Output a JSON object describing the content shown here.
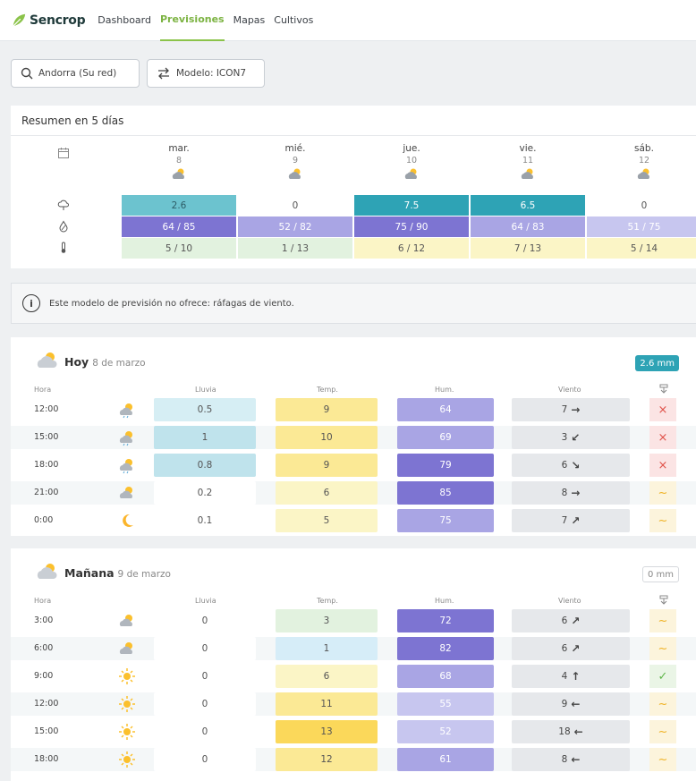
{
  "nav": {
    "brand": "Sencrop",
    "links": [
      "Dashboard",
      "Previsiones",
      "Mapas",
      "Cultivos"
    ],
    "active": "Previsiones"
  },
  "toolbar": {
    "location": "Andorra (Su red)",
    "model": "Modelo: ICON7"
  },
  "summary": {
    "title": "Resumen en 5 días",
    "days": [
      {
        "name": "mar.",
        "num": "8",
        "icon": "partly-cloudy-rain-icon",
        "rain": "2.6",
        "hum": "64 / 85",
        "temp": "5 / 10"
      },
      {
        "name": "mié.",
        "num": "9",
        "icon": "partly-cloudy-icon",
        "rain": "0",
        "hum": "52 / 82",
        "temp": "1 / 13"
      },
      {
        "name": "jue.",
        "num": "10",
        "icon": "cloudy-rain-icon",
        "rain": "7.5",
        "hum": "75 / 90",
        "temp": "6 / 12"
      },
      {
        "name": "vie.",
        "num": "11",
        "icon": "partly-cloudy-rain-icon",
        "rain": "6.5",
        "hum": "64 / 83",
        "temp": "7 / 13"
      },
      {
        "name": "sáb.",
        "num": "12",
        "icon": "partly-cloudy-icon",
        "rain": "0",
        "hum": "51 / 75",
        "temp": "5 / 14"
      }
    ]
  },
  "info": {
    "text": "Este modelo de previsión no ofrece: ráfagas de viento."
  },
  "today": {
    "title": "Hoy",
    "date": "8 de marzo",
    "total": "2.6 mm",
    "headers": {
      "hour": "Hora",
      "rain": "Lluvia",
      "temp": "Temp.",
      "hum": "Hum.",
      "wind": "Viento"
    },
    "rows": [
      {
        "hour": "12:00",
        "rain": "0.5",
        "temp": "9",
        "hum": "64",
        "wind": "7",
        "dir": "→",
        "flag": "×"
      },
      {
        "hour": "15:00",
        "rain": "1",
        "temp": "10",
        "hum": "69",
        "wind": "3",
        "dir": "↙",
        "flag": "×"
      },
      {
        "hour": "18:00",
        "rain": "0.8",
        "temp": "9",
        "hum": "79",
        "wind": "6",
        "dir": "↘",
        "flag": "×"
      },
      {
        "hour": "21:00",
        "rain": "0.2",
        "temp": "6",
        "hum": "85",
        "wind": "8",
        "dir": "→",
        "flag": "~"
      },
      {
        "hour": "0:00",
        "rain": "0.1",
        "temp": "5",
        "hum": "75",
        "wind": "7",
        "dir": "↗",
        "flag": "~"
      }
    ]
  },
  "tomorrow": {
    "title": "Mañana",
    "date": "9 de marzo",
    "total": "0 mm",
    "headers": {
      "hour": "Hora",
      "rain": "Lluvia",
      "temp": "Temp.",
      "hum": "Hum.",
      "wind": "Viento"
    },
    "rows": [
      {
        "hour": "3:00",
        "rain": "0",
        "temp": "3",
        "hum": "72",
        "wind": "6",
        "dir": "↗",
        "flag": "~"
      },
      {
        "hour": "6:00",
        "rain": "0",
        "temp": "1",
        "hum": "82",
        "wind": "6",
        "dir": "↗",
        "flag": "~"
      },
      {
        "hour": "9:00",
        "rain": "0",
        "temp": "6",
        "hum": "68",
        "wind": "4",
        "dir": "↑",
        "flag": "✓"
      },
      {
        "hour": "12:00",
        "rain": "0",
        "temp": "11",
        "hum": "55",
        "wind": "9",
        "dir": "←",
        "flag": "~"
      },
      {
        "hour": "15:00",
        "rain": "0",
        "temp": "13",
        "hum": "52",
        "wind": "18",
        "dir": "←",
        "flag": "~"
      },
      {
        "hour": "18:00",
        "rain": "0",
        "temp": "12",
        "hum": "61",
        "wind": "8",
        "dir": "←",
        "flag": "~"
      }
    ]
  },
  "colors": {
    "brand": "#7cb342",
    "rain_light": "#d6eef4",
    "rain_mid": "#bfe3ec",
    "rain_dark": "#2ea3b5",
    "rain_teal": "#6cc3cf",
    "hum_light": "#c7c6ef",
    "hum_mid": "#a9a5e4",
    "hum_dark": "#7d74d2",
    "temp_cold": "#d6edf8",
    "temp_cool": "#e2f2df",
    "temp_mild": "#fbf5c6",
    "temp_warm": "#fbe995",
    "temp_hot": "#fbd85a",
    "bad": "#fbe4e4",
    "ok": "#eaf5e6",
    "warn": "#fcf4dc"
  }
}
